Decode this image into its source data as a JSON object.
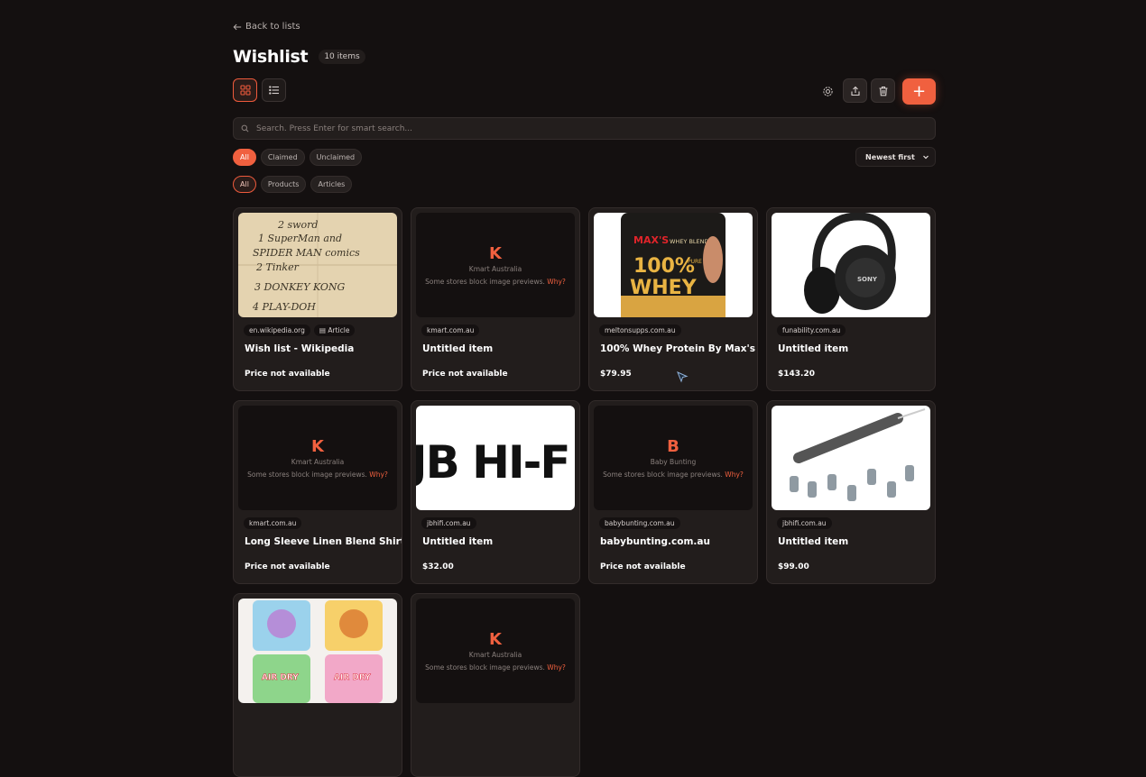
{
  "back_label": "Back to lists",
  "page_title": "Wishlist",
  "item_count": "10 items",
  "search": {
    "placeholder": "Search. Press Enter for smart search..."
  },
  "claim_filters": [
    "All",
    "Claimed",
    "Unclaimed"
  ],
  "type_filters": [
    "All",
    "Products",
    "Articles"
  ],
  "sort": {
    "selected": "Newest first"
  },
  "accent": "#f0603f",
  "items": [
    {
      "domain": "en.wikipedia.org",
      "badge": "Article",
      "name": "Wish list - Wikipedia",
      "price": "Price not available",
      "image": "wikipedia-note"
    },
    {
      "domain": "kmart.com.au",
      "name": "Untitled item",
      "price": "Price not available",
      "image": "placeholder",
      "ph_letter": "K",
      "ph_store": "Kmart Australia",
      "ph_note": "Some stores block image previews.",
      "ph_why": "Why?"
    },
    {
      "domain": "meltonsupps.com.au",
      "name": "100% Whey Protein By Max's",
      "price": "$79.95",
      "image": "whey-tub"
    },
    {
      "domain": "funability.com.au",
      "name": "Untitled item",
      "price": "$143.20",
      "image": "headphones"
    },
    {
      "domain": "kmart.com.au",
      "name": "Long Sleeve Linen Blend Shirt S",
      "price": "Price not available",
      "image": "placeholder",
      "ph_letter": "K",
      "ph_store": "Kmart Australia",
      "ph_note": "Some stores block image previews.",
      "ph_why": "Why?"
    },
    {
      "domain": "jbhifi.com.au",
      "name": "Untitled item",
      "price": "$32.00",
      "image": "jbhifi-logo",
      "logo_text": "JB HI-F"
    },
    {
      "domain": "babybunting.com.au",
      "name": "babybunting.com.au",
      "price": "Price not available",
      "image": "placeholder",
      "ph_letter": "B",
      "ph_store": "Baby Bunting",
      "ph_note": "Some stores block image previews.",
      "ph_why": "Why?"
    },
    {
      "domain": "jbhifi.com.au",
      "name": "Untitled item",
      "price": "$99.00",
      "image": "nail-drill"
    },
    {
      "image": "clay-kits"
    },
    {
      "image": "placeholder",
      "ph_letter": "K",
      "ph_store": "Kmart Australia",
      "ph_note": "Some stores block image previews.",
      "ph_why": "Why?"
    }
  ],
  "image_text": {
    "note_lines": [
      "2 sword",
      "1 SuperMan and",
      "SPIDER MAN comics",
      "2 Tinker",
      "3 DONKEY KONG",
      "4 PLAY-DOH"
    ],
    "whey_brand": "MAX'S",
    "whey_sub": "WHEY BLEND",
    "whey_big": "100%",
    "whey_pure": "PURE",
    "whey_word": "WHEY",
    "headphones_brand": "SONY",
    "clay_label": "AIR DRY"
  }
}
